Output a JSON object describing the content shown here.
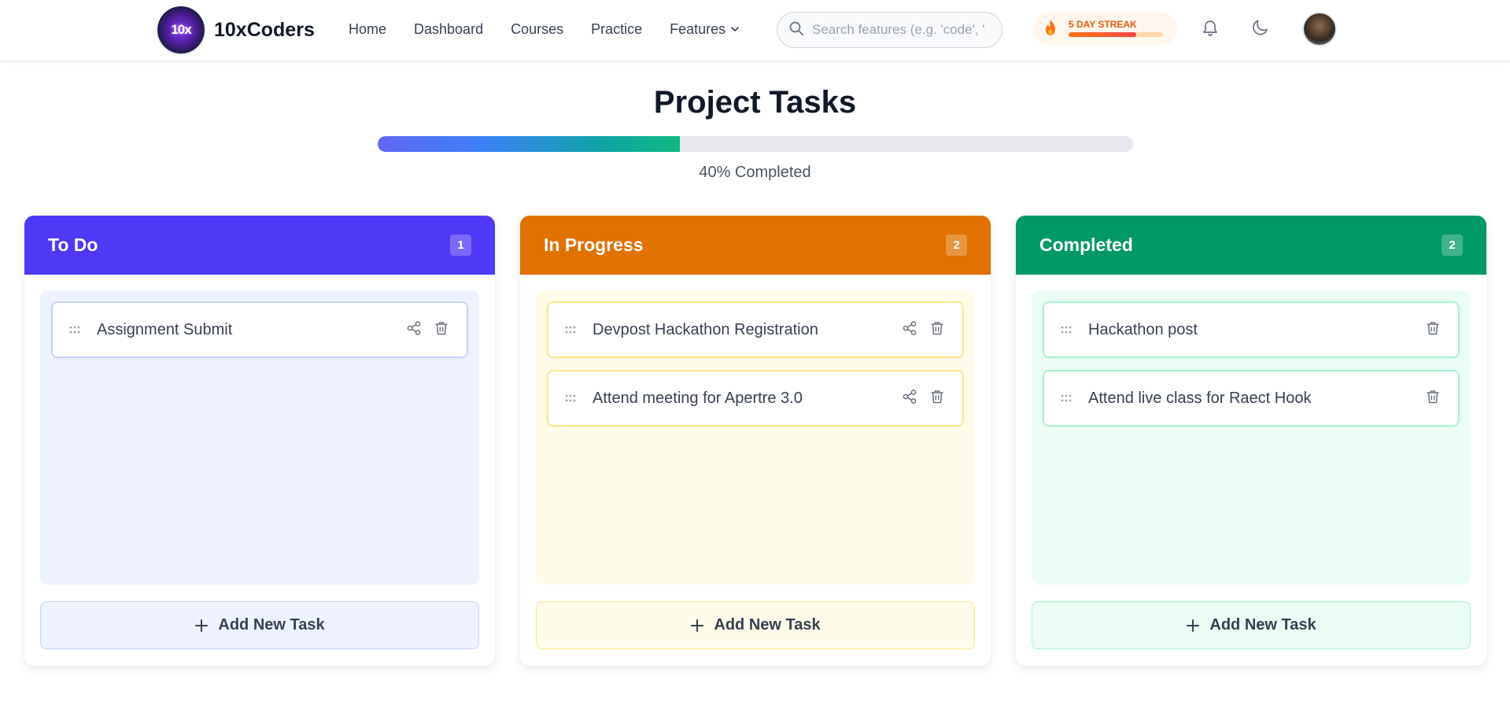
{
  "app": {
    "brand": "10xCoders",
    "logo_text": "10x"
  },
  "nav": {
    "links": [
      "Home",
      "Dashboard",
      "Courses",
      "Practice",
      "Features"
    ]
  },
  "search": {
    "placeholder": "Search features (e.g. 'code', 'pra"
  },
  "streak": {
    "label": "5 DAY STREAK",
    "progress": 0.72
  },
  "page": {
    "title": "Project Tasks",
    "progress_percent": 40,
    "progress_label": "40% Completed"
  },
  "columns": [
    {
      "title": "To Do",
      "count": "1",
      "header_color": "#4f39f6",
      "body_color": "#eef2ff",
      "card_border": "#c7d2fe",
      "add_bg": "#eef2ff",
      "add_border": "#c7d2fe",
      "tasks": [
        {
          "name": "Assignment Submit",
          "share": true
        }
      ],
      "add_label": "Add New Task"
    },
    {
      "title": "In Progress",
      "count": "2",
      "header_color": "#e17100",
      "body_color": "#fffbeb",
      "card_border": "#fde68a",
      "add_bg": "#fffbeb",
      "add_border": "#fde68a",
      "tasks": [
        {
          "name": "Devpost Hackathon Registration",
          "share": true
        },
        {
          "name": "Attend meeting for Apertre 3.0",
          "share": true
        }
      ],
      "add_label": "Add New Task"
    },
    {
      "title": "Completed",
      "count": "2",
      "header_color": "#009966",
      "body_color": "#ecfdf5",
      "card_border": "#a7f3d0",
      "add_bg": "#ecfdf5",
      "add_border": "#a7f3d0",
      "tasks": [
        {
          "name": "Hackathon post",
          "share": false
        },
        {
          "name": "Attend live class for Raect Hook",
          "share": false
        }
      ],
      "add_label": "Add New Task"
    }
  ],
  "icons": {
    "search": "search-icon",
    "flame": "flame-icon",
    "bell": "bell-icon",
    "theme": "moon-icon",
    "chevron": "chevron-down-icon",
    "drag": "drag-handle-icon",
    "share": "share-icon",
    "delete": "trash-icon",
    "add": "plus-icon"
  }
}
